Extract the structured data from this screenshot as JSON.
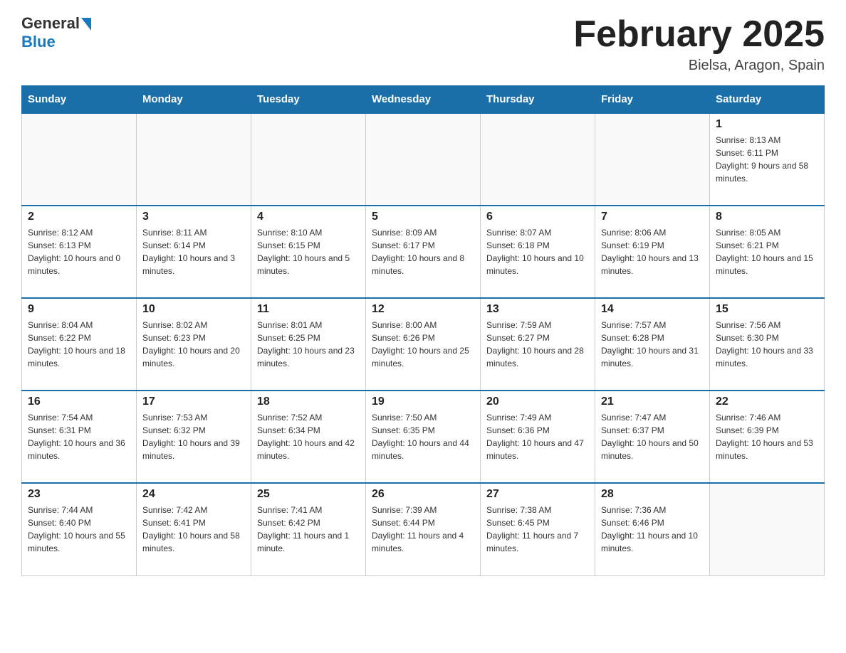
{
  "header": {
    "logo_general": "General",
    "logo_blue": "Blue",
    "title": "February 2025",
    "location": "Bielsa, Aragon, Spain"
  },
  "weekdays": [
    "Sunday",
    "Monday",
    "Tuesday",
    "Wednesday",
    "Thursday",
    "Friday",
    "Saturday"
  ],
  "weeks": [
    [
      {
        "day": "",
        "info": ""
      },
      {
        "day": "",
        "info": ""
      },
      {
        "day": "",
        "info": ""
      },
      {
        "day": "",
        "info": ""
      },
      {
        "day": "",
        "info": ""
      },
      {
        "day": "",
        "info": ""
      },
      {
        "day": "1",
        "info": "Sunrise: 8:13 AM\nSunset: 6:11 PM\nDaylight: 9 hours and 58 minutes."
      }
    ],
    [
      {
        "day": "2",
        "info": "Sunrise: 8:12 AM\nSunset: 6:13 PM\nDaylight: 10 hours and 0 minutes."
      },
      {
        "day": "3",
        "info": "Sunrise: 8:11 AM\nSunset: 6:14 PM\nDaylight: 10 hours and 3 minutes."
      },
      {
        "day": "4",
        "info": "Sunrise: 8:10 AM\nSunset: 6:15 PM\nDaylight: 10 hours and 5 minutes."
      },
      {
        "day": "5",
        "info": "Sunrise: 8:09 AM\nSunset: 6:17 PM\nDaylight: 10 hours and 8 minutes."
      },
      {
        "day": "6",
        "info": "Sunrise: 8:07 AM\nSunset: 6:18 PM\nDaylight: 10 hours and 10 minutes."
      },
      {
        "day": "7",
        "info": "Sunrise: 8:06 AM\nSunset: 6:19 PM\nDaylight: 10 hours and 13 minutes."
      },
      {
        "day": "8",
        "info": "Sunrise: 8:05 AM\nSunset: 6:21 PM\nDaylight: 10 hours and 15 minutes."
      }
    ],
    [
      {
        "day": "9",
        "info": "Sunrise: 8:04 AM\nSunset: 6:22 PM\nDaylight: 10 hours and 18 minutes."
      },
      {
        "day": "10",
        "info": "Sunrise: 8:02 AM\nSunset: 6:23 PM\nDaylight: 10 hours and 20 minutes."
      },
      {
        "day": "11",
        "info": "Sunrise: 8:01 AM\nSunset: 6:25 PM\nDaylight: 10 hours and 23 minutes."
      },
      {
        "day": "12",
        "info": "Sunrise: 8:00 AM\nSunset: 6:26 PM\nDaylight: 10 hours and 25 minutes."
      },
      {
        "day": "13",
        "info": "Sunrise: 7:59 AM\nSunset: 6:27 PM\nDaylight: 10 hours and 28 minutes."
      },
      {
        "day": "14",
        "info": "Sunrise: 7:57 AM\nSunset: 6:28 PM\nDaylight: 10 hours and 31 minutes."
      },
      {
        "day": "15",
        "info": "Sunrise: 7:56 AM\nSunset: 6:30 PM\nDaylight: 10 hours and 33 minutes."
      }
    ],
    [
      {
        "day": "16",
        "info": "Sunrise: 7:54 AM\nSunset: 6:31 PM\nDaylight: 10 hours and 36 minutes."
      },
      {
        "day": "17",
        "info": "Sunrise: 7:53 AM\nSunset: 6:32 PM\nDaylight: 10 hours and 39 minutes."
      },
      {
        "day": "18",
        "info": "Sunrise: 7:52 AM\nSunset: 6:34 PM\nDaylight: 10 hours and 42 minutes."
      },
      {
        "day": "19",
        "info": "Sunrise: 7:50 AM\nSunset: 6:35 PM\nDaylight: 10 hours and 44 minutes."
      },
      {
        "day": "20",
        "info": "Sunrise: 7:49 AM\nSunset: 6:36 PM\nDaylight: 10 hours and 47 minutes."
      },
      {
        "day": "21",
        "info": "Sunrise: 7:47 AM\nSunset: 6:37 PM\nDaylight: 10 hours and 50 minutes."
      },
      {
        "day": "22",
        "info": "Sunrise: 7:46 AM\nSunset: 6:39 PM\nDaylight: 10 hours and 53 minutes."
      }
    ],
    [
      {
        "day": "23",
        "info": "Sunrise: 7:44 AM\nSunset: 6:40 PM\nDaylight: 10 hours and 55 minutes."
      },
      {
        "day": "24",
        "info": "Sunrise: 7:42 AM\nSunset: 6:41 PM\nDaylight: 10 hours and 58 minutes."
      },
      {
        "day": "25",
        "info": "Sunrise: 7:41 AM\nSunset: 6:42 PM\nDaylight: 11 hours and 1 minute."
      },
      {
        "day": "26",
        "info": "Sunrise: 7:39 AM\nSunset: 6:44 PM\nDaylight: 11 hours and 4 minutes."
      },
      {
        "day": "27",
        "info": "Sunrise: 7:38 AM\nSunset: 6:45 PM\nDaylight: 11 hours and 7 minutes."
      },
      {
        "day": "28",
        "info": "Sunrise: 7:36 AM\nSunset: 6:46 PM\nDaylight: 11 hours and 10 minutes."
      },
      {
        "day": "",
        "info": ""
      }
    ]
  ]
}
